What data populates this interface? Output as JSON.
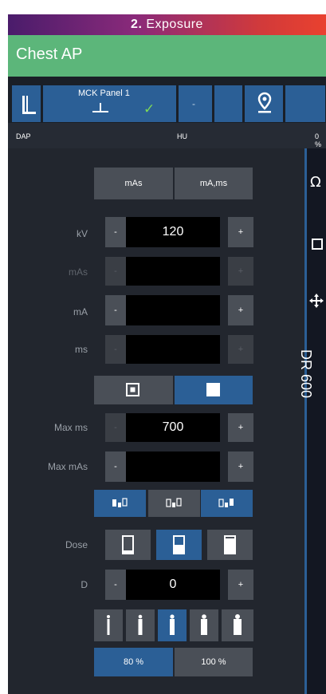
{
  "banner": {
    "step_number": "2.",
    "step_title": "Exposure"
  },
  "exam": {
    "name": "Chest AP"
  },
  "panel": {
    "name": "MCK Panel 1",
    "status_icon": "check-icon",
    "placeholder": "-"
  },
  "info": {
    "dap_label": "DAP",
    "hu_label": "HU",
    "pct": "0 %"
  },
  "mode_buttons": {
    "mas": "mAs",
    "ma_ms": "mA,ms"
  },
  "params": {
    "kv": {
      "label": "kV",
      "value": "120",
      "minus": "-",
      "plus": "+"
    },
    "mas": {
      "label": "mAs",
      "value": "",
      "minus": "-",
      "plus": "+"
    },
    "ma": {
      "label": "mA",
      "value": "",
      "minus": "-",
      "plus": "+"
    },
    "ms": {
      "label": "ms",
      "value": "",
      "minus": "-",
      "plus": "+"
    },
    "max_ms": {
      "label": "Max ms",
      "value": "700",
      "minus": "-",
      "plus": "+"
    },
    "max_mas": {
      "label": "Max mAs",
      "value": "",
      "minus": "-",
      "plus": "+"
    },
    "d": {
      "label": "D",
      "value": "0",
      "minus": "-",
      "plus": "+"
    }
  },
  "dose": {
    "label": "Dose",
    "selected": "medium"
  },
  "percent": {
    "p80": "80 %",
    "p100": "100 %",
    "selected": "80 %"
  },
  "side": {
    "label": "DR 600"
  },
  "colors": {
    "accent": "#2b5f96",
    "exam_header": "#5cb67a",
    "check": "#7ed957"
  }
}
